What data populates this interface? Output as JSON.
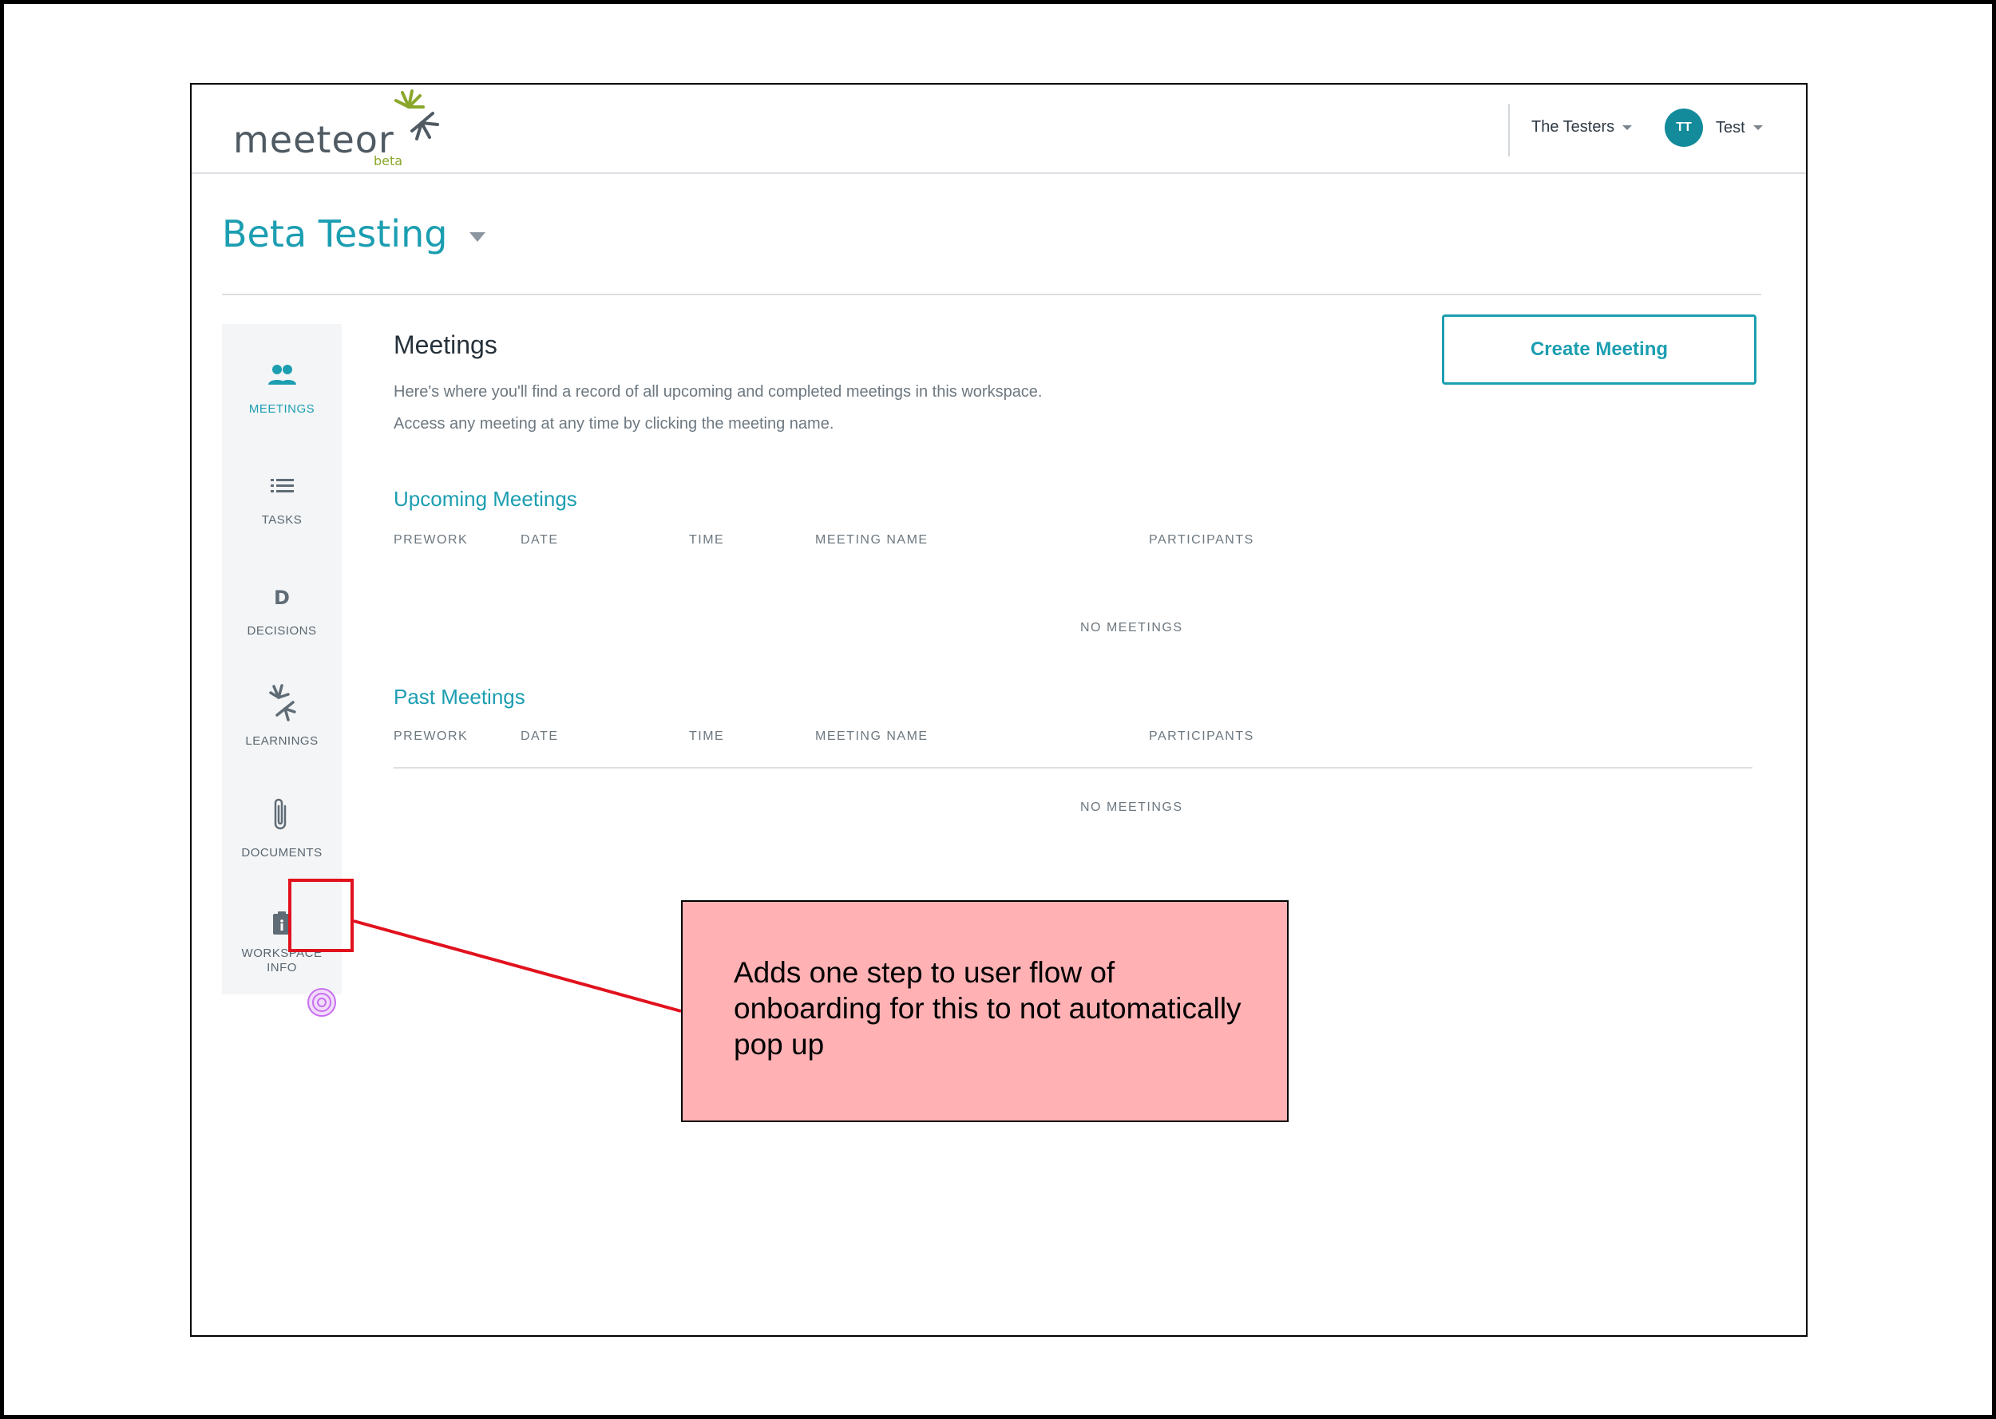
{
  "header": {
    "logo_text": "meeteor",
    "logo_badge": "beta",
    "workspace_menu": "The Testers",
    "user_initials": "TT",
    "user_name": "Test"
  },
  "page": {
    "title": "Beta Testing"
  },
  "sidebar": {
    "items": [
      {
        "label": "MEETINGS",
        "icon": "people-icon",
        "active": true
      },
      {
        "label": "TASKS",
        "icon": "list-icon",
        "active": false
      },
      {
        "label": "DECISIONS",
        "icon": "decision-d-icon",
        "active": false
      },
      {
        "label": "LEARNINGS",
        "icon": "meeteor-burst-icon",
        "active": false
      },
      {
        "label": "DOCUMENTS",
        "icon": "paperclip-icon",
        "active": false
      },
      {
        "label_line1": "WORKSPACE",
        "label_line2": "INFO",
        "icon": "clipboard-info-icon",
        "active": false
      }
    ]
  },
  "meetings": {
    "title": "Meetings",
    "description_1": "Here's where you'll find a record of all upcoming and completed meetings in this workspace.",
    "description_2": "Access any meeting at any time by clicking the meeting name.",
    "create_button": "Create Meeting",
    "columns": [
      "PREWORK",
      "DATE",
      "TIME",
      "MEETING NAME",
      "PARTICIPANTS"
    ],
    "upcoming": {
      "title": "Upcoming Meetings",
      "empty": "NO MEETINGS"
    },
    "past": {
      "title": "Past Meetings",
      "empty": "NO MEETINGS"
    }
  },
  "annotation": {
    "text": "Adds one step to user flow of onboarding for this to not automatically pop up",
    "highlight_color": "#e1121e",
    "box_color": "#ffb1b4"
  },
  "colors": {
    "accent": "#1c9eb1",
    "avatar": "#138b9b",
    "sidebar_bg": "#f4f5f6",
    "hotspot": "#c86ef0"
  }
}
